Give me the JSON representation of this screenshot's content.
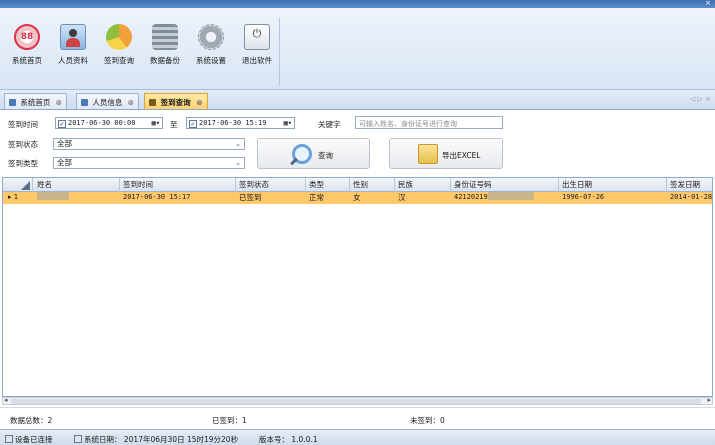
{
  "window": {
    "title": "",
    "close": "×"
  },
  "toolbar": {
    "buttons": [
      {
        "label": "系统首页",
        "icon": "home-icon",
        "glyph": "88"
      },
      {
        "label": "人员资料",
        "icon": "user-card-icon"
      },
      {
        "label": "签到查询",
        "icon": "pie-chart-icon"
      },
      {
        "label": "数据备份",
        "icon": "database-icon"
      },
      {
        "label": "系统设置",
        "icon": "gear-icon"
      },
      {
        "label": "退出软件",
        "icon": "power-icon",
        "glyph": "⏻"
      }
    ]
  },
  "tabs": [
    {
      "label": "系统首页"
    },
    {
      "label": "人员信息"
    },
    {
      "label": "签到查询",
      "active": true
    }
  ],
  "tab_nav": "◁ ▷ ×",
  "filters": {
    "sign_time_label": "签到时间",
    "start": "2017-06-30 00:00",
    "to_label": "至",
    "end": "2017-06-30 15:19",
    "keyword_label": "关键字",
    "keyword_placeholder": "可输入姓名、身份证号进行查询",
    "status_label": "签到状态",
    "status_value": "全部",
    "type_label": "签到类型",
    "type_value": "全部",
    "query_button": "查询",
    "export_button": "导出EXCEL"
  },
  "grid": {
    "columns": [
      "姓名",
      "签到时间",
      "签到状态",
      "类型",
      "性别",
      "民族",
      "身份证号码",
      "出生日期",
      "签发日期"
    ],
    "rows": [
      {
        "index": "1",
        "name": "",
        "sign_time": "2017-06-30 15:17",
        "status": "已签到",
        "type": "正常",
        "gender": "女",
        "ethnicity": "汉",
        "id_number": "42120219",
        "birth_date": "1996-07-26",
        "issue_date": "2014-01-28"
      }
    ]
  },
  "summary": {
    "total": "数据总数：2",
    "signed": "已签到：1",
    "unsigned": "未签到：0"
  },
  "status_bar": {
    "device": "设备已连接",
    "date_label": "系统日期：",
    "date": "2017年06月30日 15时19分20秒",
    "version_label": "版本号：",
    "version": "1.0.0.1"
  },
  "colors": {
    "selected_row": "#ffc96b",
    "active_tab": "#ffd36e",
    "accent": "#4a79b8"
  }
}
